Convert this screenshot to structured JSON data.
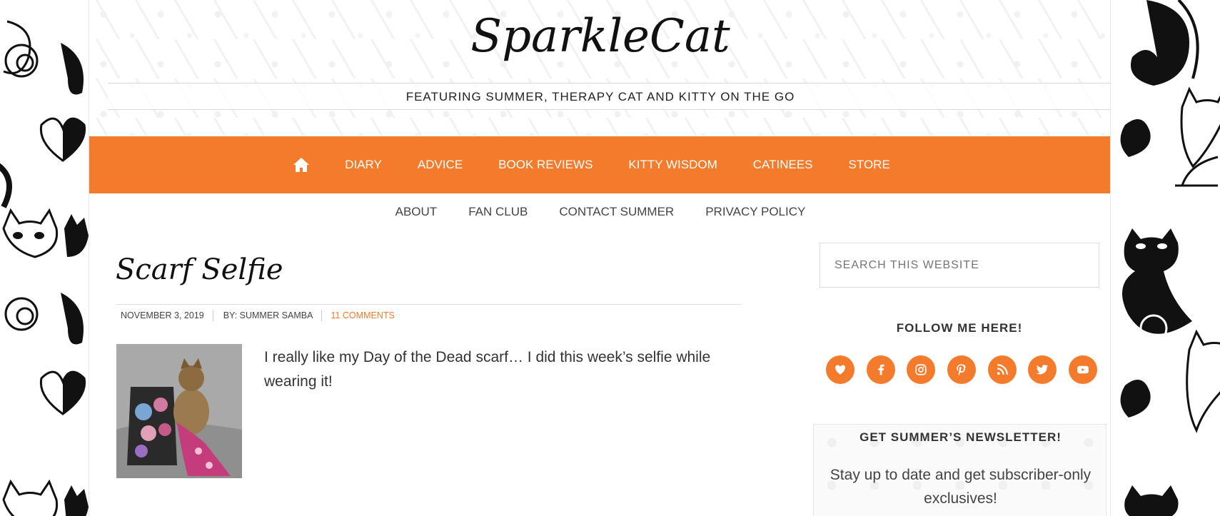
{
  "site": {
    "title": "SparkleCat",
    "tagline": "FEATURING SUMMER, THERAPY CAT AND KITTY ON THE GO"
  },
  "nav_primary": {
    "home_icon": "home-icon",
    "items": [
      "DIARY",
      "ADVICE",
      "BOOK REVIEWS",
      "KITTY WISDOM",
      "CATINEES",
      "STORE"
    ]
  },
  "nav_secondary": {
    "items": [
      "ABOUT",
      "FAN CLUB",
      "CONTACT SUMMER",
      "PRIVACY POLICY"
    ]
  },
  "post": {
    "title": "Scarf Selfie",
    "date": "NOVEMBER 3, 2019",
    "author": "BY: SUMMER SAMBA",
    "comments": "11 COMMENTS",
    "excerpt": "I really like my Day of the Dead scarf… I did this week’s selfie while wearing it!"
  },
  "sidebar": {
    "search_placeholder": "SEARCH THIS WEBSITE",
    "follow_title": "FOLLOW ME HERE!",
    "social_icons": [
      "heart-icon",
      "facebook-icon",
      "instagram-icon",
      "pinterest-icon",
      "rss-icon",
      "twitter-icon",
      "youtube-icon"
    ],
    "newsletter_title": "GET SUMMER’S NEWSLETTER!",
    "newsletter_text": "Stay up to date and get subscriber-only exclusives!"
  },
  "colors": {
    "accent": "#f47b2c",
    "text": "#333333"
  }
}
